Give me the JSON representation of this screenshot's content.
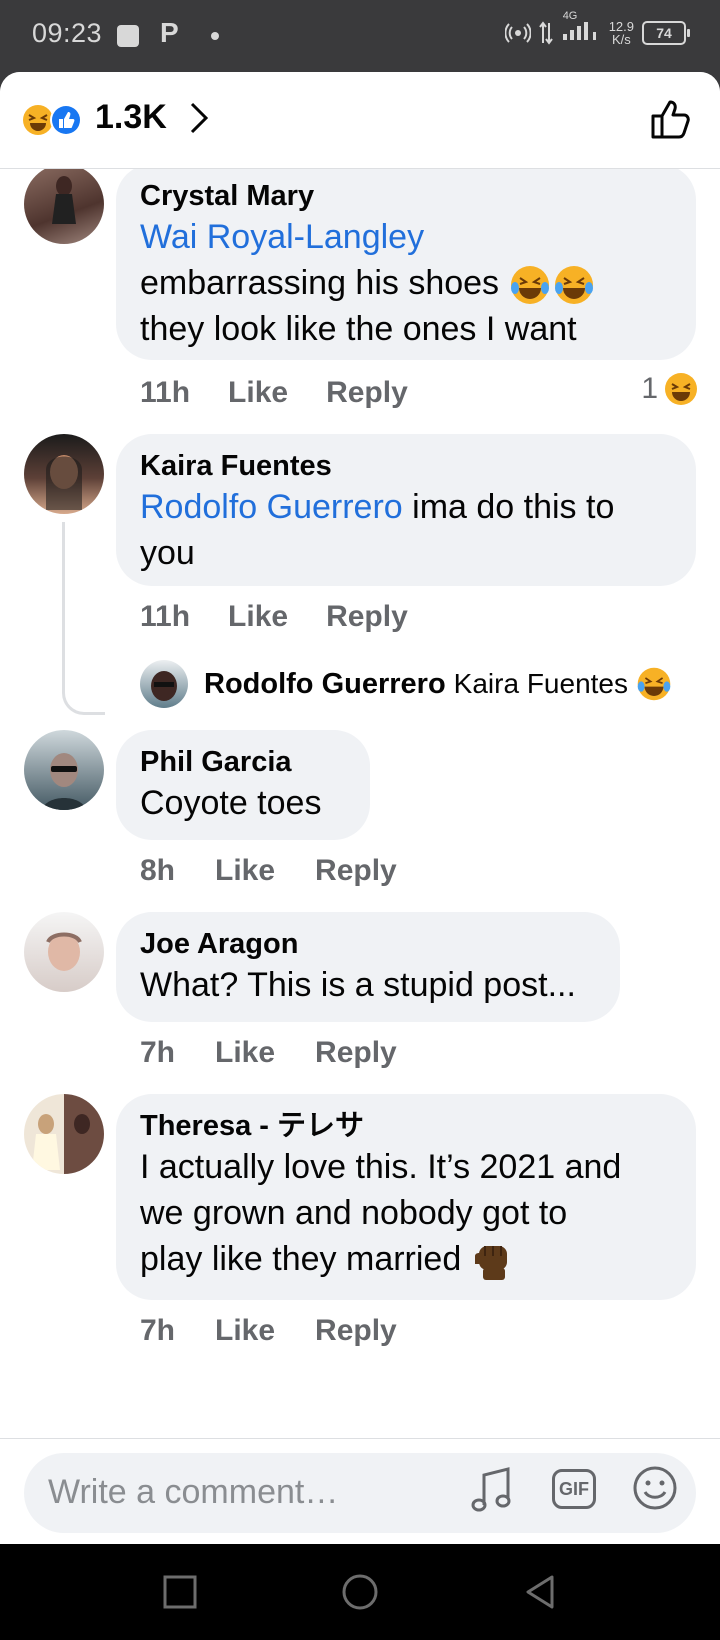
{
  "status_bar": {
    "time": "09:23",
    "p_icon": "P",
    "net_type": "4G",
    "speed_value": "12.9",
    "speed_unit": "K/s",
    "battery": "74"
  },
  "header": {
    "reaction_count": "1.3K"
  },
  "comments": [
    {
      "author": "Crystal Mary",
      "mention": "Wai Royal-Langley",
      "text_line1": "embarrassing his shoes",
      "text_line2": "they look like the ones I want",
      "time": "11h",
      "like": "Like",
      "reply": "Reply",
      "reaction_count": "1"
    },
    {
      "author": "Kaira Fuentes",
      "mention": "Rodolfo Guerrero",
      "text_inline": "ima do this to",
      "text_line2": "you",
      "time": "11h",
      "like": "Like",
      "reply": "Reply",
      "reply_preview": {
        "author": "Rodolfo Guerrero",
        "text": "Kaira Fuentes"
      }
    },
    {
      "author": "Phil Garcia",
      "text": "Coyote toes",
      "time": "8h",
      "like": "Like",
      "reply": "Reply"
    },
    {
      "author": "Joe Aragon",
      "text": "What? This is a stupid post...",
      "time": "7h",
      "like": "Like",
      "reply": "Reply"
    },
    {
      "author": "Theresa - テレサ",
      "text_line1": "I actually love this. It’s 2021 and",
      "text_line2": "we grown and nobody got to",
      "text_line3": "play like they married",
      "time": "7h",
      "like": "Like",
      "reply": "Reply"
    }
  ],
  "composer": {
    "placeholder": "Write a comment…",
    "gif_label": "GIF"
  },
  "colors": {
    "mention": "#216fdb",
    "bubble": "#f0f2f5",
    "meta": "#65676b"
  },
  "icons": [
    "haha-reaction-icon",
    "like-reaction-icon",
    "chevron-right-icon",
    "thumbs-up-icon",
    "music-note-icon",
    "gif-icon",
    "smiley-icon",
    "recents-icon",
    "home-icon",
    "back-icon"
  ]
}
